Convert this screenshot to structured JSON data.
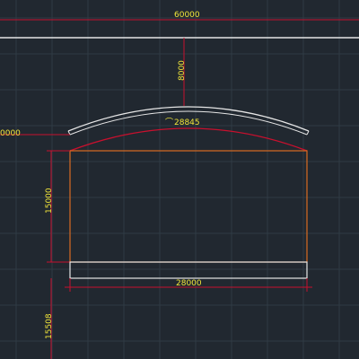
{
  "drawing": {
    "dim_top_width": "60000",
    "dim_vertical_height": "8000",
    "dim_arc_length": "28845",
    "dim_left_offset": "0000",
    "dim_left_height": "15000",
    "dim_bottom_width": "28000",
    "dim_bottom_height": "15508"
  },
  "colors": {
    "background": "#212830",
    "grid": "#2f3a44",
    "dimension_line": "#c8102e",
    "text": "#f2e63a",
    "structure_white": "#e6e6e6",
    "structure_orange": "#d96b22"
  }
}
